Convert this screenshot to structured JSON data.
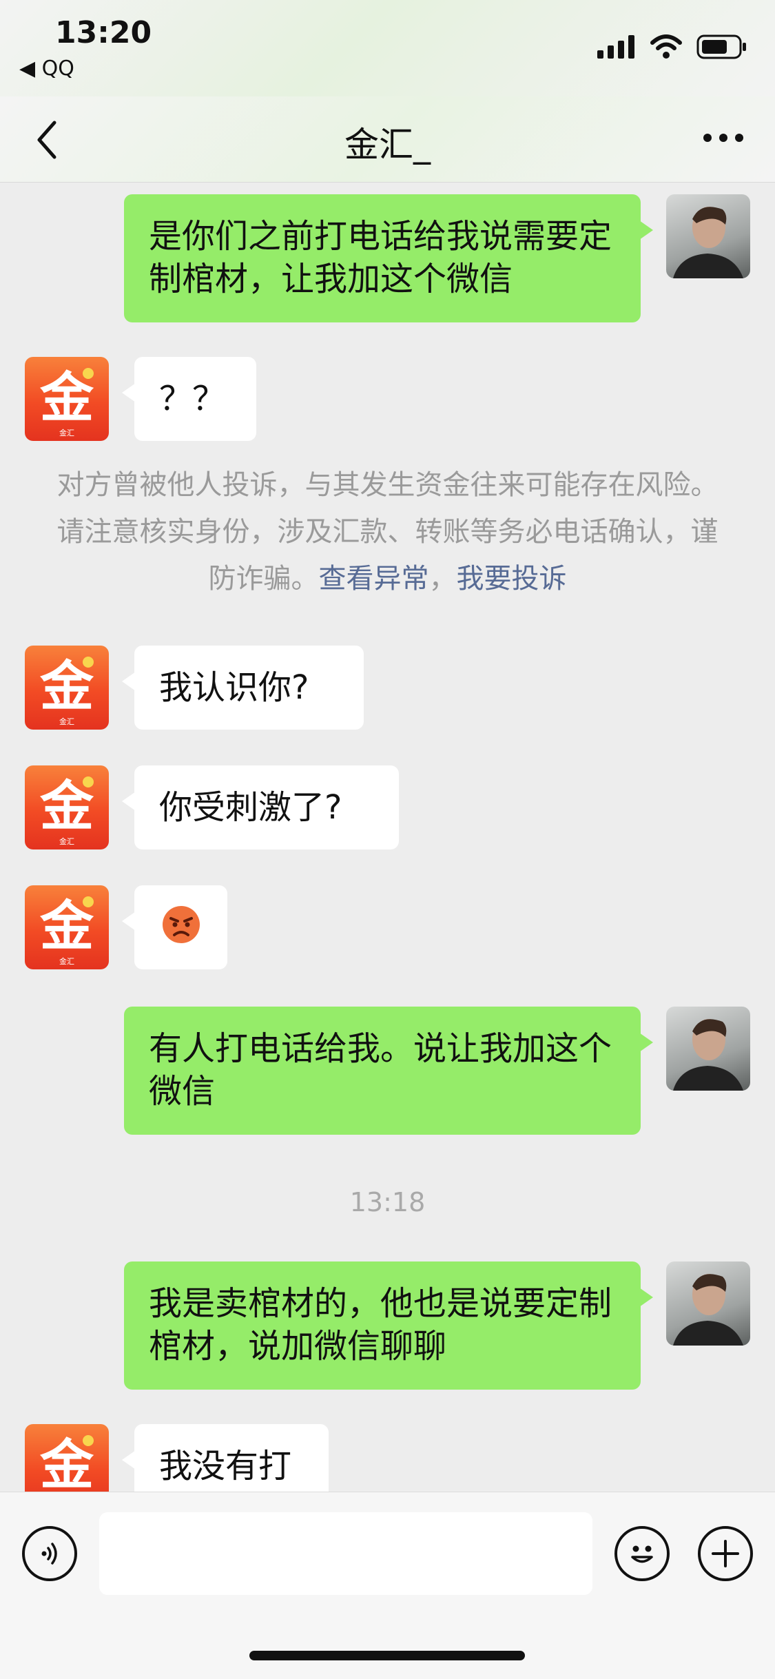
{
  "status": {
    "time": "13:20",
    "back_app": "◀ QQ"
  },
  "nav": {
    "title": "金汇_"
  },
  "avatars": {
    "other_logo_text": "金",
    "other_logo_sub": "金汇"
  },
  "messages": [
    {
      "from": "me",
      "text": "是你们之前打电话给我说需要定制棺材，让我加这个微信"
    },
    {
      "from": "other",
      "text": "？？"
    },
    {
      "from": "other",
      "text": "我认识你?"
    },
    {
      "from": "other",
      "text": "你受刺激了?"
    },
    {
      "from": "other",
      "text": "😡"
    },
    {
      "from": "me",
      "text": "有人打电话给我。说让我加这个微信"
    },
    {
      "from": "me",
      "text": "我是卖棺材的，他也是说要定制棺材，说加微信聊聊"
    },
    {
      "from": "other",
      "text": "我没有打"
    }
  ],
  "notice": {
    "text": "对方曾被他人投诉，与其发生资金往来可能存在风险。请注意核实身份，涉及汇款、转账等务必电话确认，谨防诈骗。",
    "link1": "查看异常",
    "separator": "，",
    "link2": "我要投诉"
  },
  "timestamp": "13:18",
  "icons": {
    "back": "chevron-left-icon",
    "more": "more-dots-icon",
    "voice": "voice-icon",
    "emoji": "emoji-icon",
    "plus": "plus-icon",
    "signal": "signal-icon",
    "wifi": "wifi-icon",
    "battery": "battery-icon"
  },
  "colors": {
    "my_bubble": "#95ec69",
    "their_bubble": "#ffffff",
    "link": "#576b95",
    "avatar_brand": "#f24b24"
  }
}
